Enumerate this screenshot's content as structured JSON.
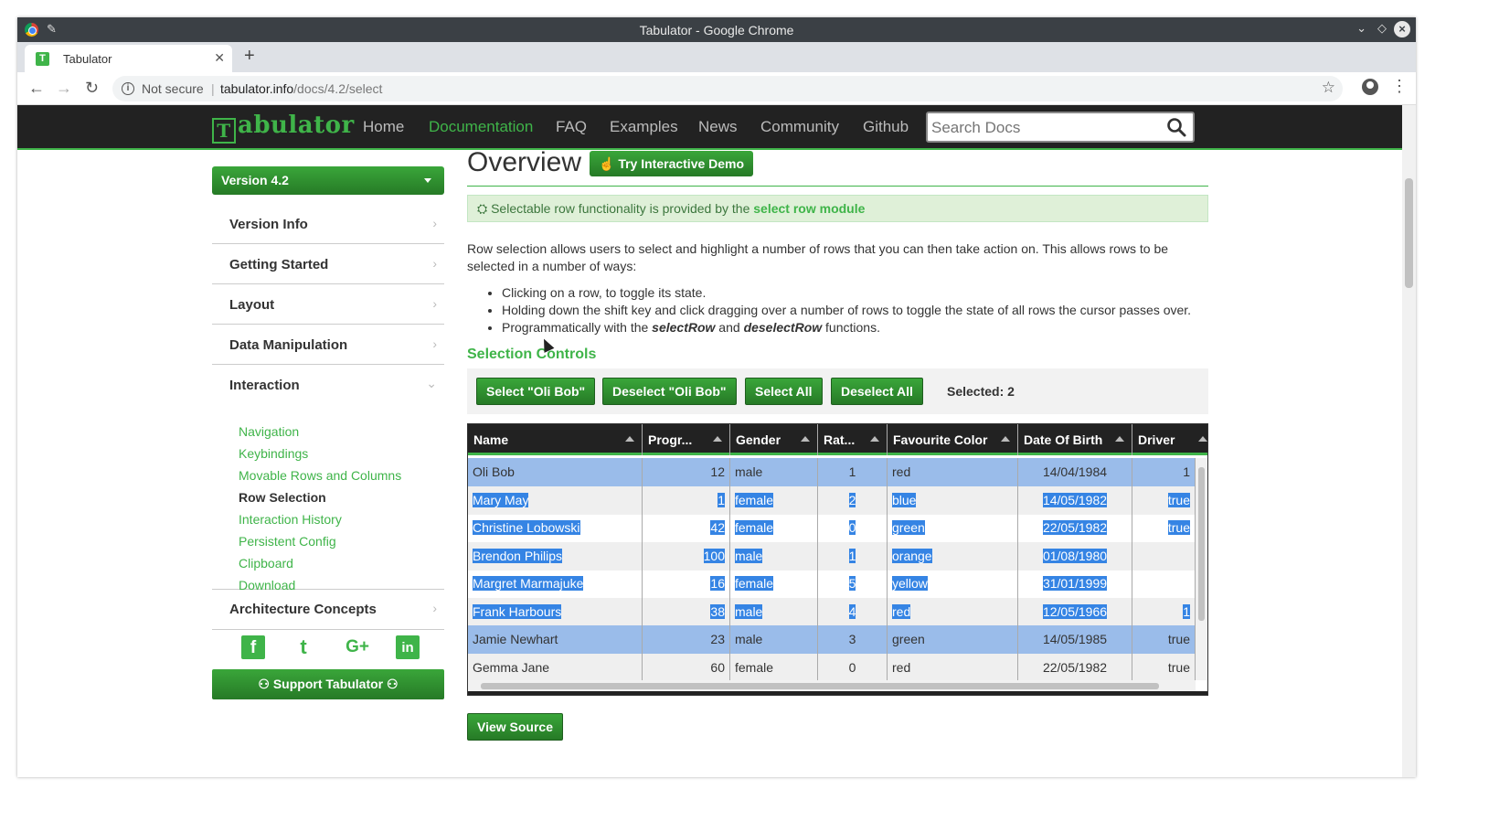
{
  "window": {
    "title": "Tabulator - Google Chrome"
  },
  "tab": {
    "title": "Tabulator",
    "favicon": "T"
  },
  "address": {
    "security": "Not secure",
    "host": "tabulator.info",
    "path": "/docs/4.2/select"
  },
  "sitenav": {
    "logo_text": "abulator",
    "logo_letter": "T",
    "items": [
      "Home",
      "Documentation",
      "FAQ",
      "Examples",
      "News",
      "Community",
      "Github"
    ],
    "active": "Documentation",
    "search_placeholder": "Search Docs"
  },
  "sidebar": {
    "version": "Version 4.2",
    "sections": [
      "Version Info",
      "Getting Started",
      "Layout",
      "Data Manipulation",
      "Interaction",
      "Architecture Concepts"
    ],
    "interaction_items": [
      "Navigation",
      "Keybindings",
      "Movable Rows and Columns",
      "Row Selection",
      "Interaction History",
      "Persistent Config",
      "Clipboard",
      "Download"
    ],
    "current_item": "Row Selection",
    "social": [
      "facebook-icon",
      "twitter-icon",
      "google-plus-icon",
      "linkedin-icon"
    ],
    "social_glyphs": [
      "f",
      "t",
      "G+",
      "in"
    ],
    "support_label": "Support Tabulator"
  },
  "main": {
    "title": "Overview",
    "demo_button": "Try Interactive Demo",
    "info_prefix": "Selectable row functionality is provided by the ",
    "info_link": "select row module",
    "intro": "Row selection allows users to select and highlight a number of rows that you can then take action on. This allows rows to be selected in a number of ways:",
    "bullet1": "Clicking on a row, to toggle its state.",
    "bullet2": "Holding down the shift key and click dragging over a number of rows to toggle the state of all rows the cursor passes over.",
    "bullet3_pre": "Programmatically with the ",
    "bullet3_fn1": "selectRow",
    "bullet3_mid": " and ",
    "bullet3_fn2": "deselectRow",
    "bullet3_post": " functions.",
    "subheading": "Selection Controls",
    "controls": {
      "select_oli": "Select \"Oli Bob\"",
      "deselect_oli": "Deselect \"Oli Bob\"",
      "select_all": "Select All",
      "deselect_all": "Deselect All",
      "selected": "Selected: 2"
    },
    "view_source": "View Source"
  },
  "table": {
    "columns": [
      "Name",
      "Progr...",
      "Gender",
      "Rat...",
      "Favourite Color",
      "Date Of Birth",
      "Driver"
    ],
    "rows": [
      {
        "name": "Oli Bob",
        "progress": "12",
        "gender": "male",
        "rating": "1",
        "color": "red",
        "dob": "14/04/1984",
        "driver": "1"
      },
      {
        "name": "Mary May",
        "progress": "1",
        "gender": "female",
        "rating": "2",
        "color": "blue",
        "dob": "14/05/1982",
        "driver": "true"
      },
      {
        "name": "Christine Lobowski",
        "progress": "42",
        "gender": "female",
        "rating": "0",
        "color": "green",
        "dob": "22/05/1982",
        "driver": "true"
      },
      {
        "name": "Brendon Philips",
        "progress": "100",
        "gender": "male",
        "rating": "1",
        "color": "orange",
        "dob": "01/08/1980",
        "driver": ""
      },
      {
        "name": "Margret Marmajuke",
        "progress": "16",
        "gender": "female",
        "rating": "5",
        "color": "yellow",
        "dob": "31/01/1999",
        "driver": ""
      },
      {
        "name": "Frank Harbours",
        "progress": "38",
        "gender": "male",
        "rating": "4",
        "color": "red",
        "dob": "12/05/1966",
        "driver": "1"
      },
      {
        "name": "Jamie Newhart",
        "progress": "23",
        "gender": "male",
        "rating": "3",
        "color": "green",
        "dob": "14/05/1985",
        "driver": "true"
      },
      {
        "name": "Gemma Jane",
        "progress": "60",
        "gender": "female",
        "rating": "0",
        "color": "red",
        "dob": "22/05/1982",
        "driver": "true"
      }
    ],
    "selected_rows": [
      0,
      6
    ],
    "text_highlighted_rows": [
      1,
      2,
      3,
      4,
      5
    ]
  }
}
